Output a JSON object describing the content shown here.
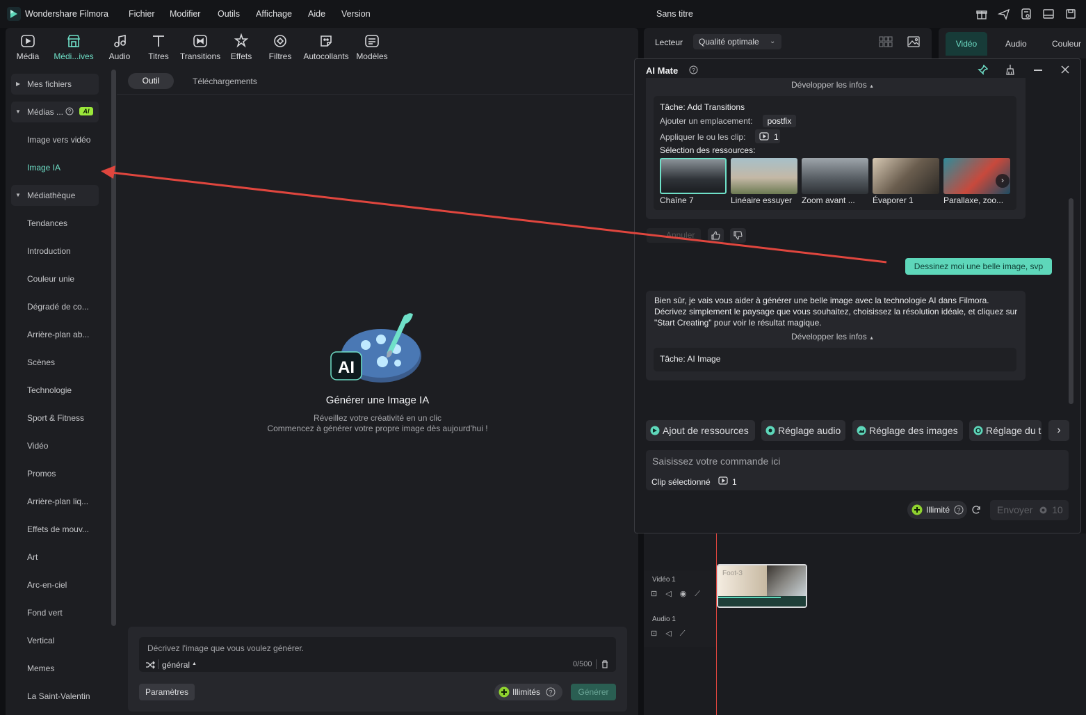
{
  "app": {
    "title": "Wondershare Filmora",
    "menu": [
      "Fichier",
      "Modifier",
      "Outils",
      "Affichage",
      "Aide",
      "Version"
    ],
    "document_title": "Sans titre"
  },
  "toolbar": {
    "items": [
      {
        "label": "Média",
        "icon": "media-icon",
        "active": false
      },
      {
        "label": "Médi...ives",
        "icon": "store-icon",
        "active": true
      },
      {
        "label": "Audio",
        "icon": "music-note-icon",
        "active": false
      },
      {
        "label": "Titres",
        "icon": "title-t-icon",
        "active": false
      },
      {
        "label": "Transitions",
        "icon": "transitions-icon",
        "active": false
      },
      {
        "label": "Effets",
        "icon": "effects-star-icon",
        "active": false
      },
      {
        "label": "Filtres",
        "icon": "filters-icon",
        "active": false
      },
      {
        "label": "Autocollants",
        "icon": "sticker-icon",
        "active": false
      },
      {
        "label": "Modèles",
        "icon": "templates-icon",
        "active": false
      }
    ]
  },
  "sidebar": {
    "groups": {
      "my_files": "Mes fichiers",
      "medias_ai": "Médias ...",
      "ai_badge": "AI",
      "library": "Médiathèque"
    },
    "items": [
      "Image vers vidéo",
      "Image IA",
      "Tendances",
      "Introduction",
      "Couleur unie",
      "Dégradé de co...",
      "Arrière-plan ab...",
      "Scènes",
      "Technologie",
      "Sport & Fitness",
      "Vidéo",
      "Promos",
      "Arrière-plan liq...",
      "Effets de mouv...",
      "Art",
      "Arc-en-ciel",
      "Fond vert",
      "Vertical",
      "Memes",
      "La Saint-Valentin"
    ],
    "active_item": "Image IA"
  },
  "content": {
    "tabs": [
      "Outil",
      "Téléchargements"
    ],
    "empty_title": "Générer une Image IA",
    "empty_sub1": "Réveillez votre créativité en un clic",
    "empty_sub2": "Commencez à générer votre propre image dès aujourd'hui !",
    "prompt_placeholder": "Décrivez l'image que vous voulez générer.",
    "style_label": "général",
    "counter": "0/500",
    "params_label": "Paramètres",
    "unlimited_label": "Illimités",
    "generate_label": "Générer"
  },
  "player": {
    "label": "Lecteur",
    "quality": "Qualité optimale"
  },
  "right_tabs": [
    "Vidéo",
    "Audio",
    "Couleur"
  ],
  "aimate": {
    "title": "AI Mate",
    "dev_infos": "Développer les infos",
    "task1": "Tâche: Add Transitions",
    "add_location_label": "Ajouter un emplacement:",
    "add_location_value": "postfix",
    "apply_clips_label": "Appliquer le ou les clip:",
    "apply_clips_count": "1",
    "resources_label": "Sélection des ressources:",
    "resources": [
      "Chaîne 7",
      "Linéaire essuyer",
      "Zoom avant ...",
      "Évaporer 1",
      "Parallaxe, zoo..."
    ],
    "undo_label": "Annuler",
    "user_message": "Dessinez moi une belle image, svp",
    "bot_message": "Bien sûr, je vais vous aider à générer une belle image avec la technologie AI dans Filmora. Décrivez simplement le paysage que vous souhaitez, choisissez la résolution idéale, et cliquez sur \"Start Creating\" pour voir le résultat magique.",
    "dev_infos2": "Développer les infos",
    "task2": "Tâche:  AI Image",
    "chips": [
      "Ajout de ressources",
      "Réglage audio",
      "Réglage des images",
      "Réglage du t"
    ],
    "command_placeholder": "Saisissez votre commande ici",
    "clip_selected_label": "Clip sélectionné",
    "clip_selected_count": "1",
    "unlimited_label": "Illimité",
    "send_label": "Envoyer",
    "send_cost": "10"
  },
  "timeline": {
    "video_track": "Vidéo 1",
    "audio_track": "Audio 1",
    "clip_name": "Foot-3"
  },
  "colors": {
    "accent": "#6fe0c8",
    "annotation_arrow": "#e0463e"
  }
}
